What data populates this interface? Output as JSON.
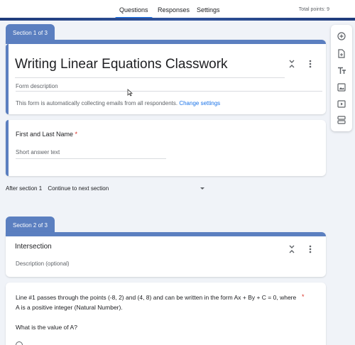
{
  "tabs": [
    {
      "label": "Questions",
      "active": true
    },
    {
      "label": "Responses",
      "active": false
    },
    {
      "label": "Settings",
      "active": false
    }
  ],
  "total_points": "Total points: 9",
  "section1": {
    "tag": "Section 1 of 3",
    "title": "Writing Linear Equations Classwork",
    "description_placeholder": "Form description",
    "email_notice": "This form is automatically collecting emails from all respondents.",
    "change_settings": "Change settings"
  },
  "question1": {
    "label": "First and Last Name",
    "required_mark": "*",
    "answer_placeholder": "Short answer text"
  },
  "after_section": {
    "label": "After section 1",
    "value": "Continue to next section"
  },
  "section2": {
    "tag": "Section 2 of 3",
    "title": "Intersection",
    "description_placeholder": "Description (optional)"
  },
  "question2": {
    "text": "Line #1 passes through the points (-8, 2) and (4, 8) and can be written in the form Ax + By + C = 0, where A is a positive integer (Natural Number).",
    "required_mark": "*",
    "sub_question": "What is the value of A?"
  },
  "sidebar_icons": [
    "add-question-icon",
    "import-questions-icon",
    "add-title-icon",
    "add-image-icon",
    "add-video-icon",
    "add-section-icon"
  ],
  "colors": {
    "accent": "#5b7fc0",
    "link": "#1a73e8",
    "required": "#d93025"
  }
}
